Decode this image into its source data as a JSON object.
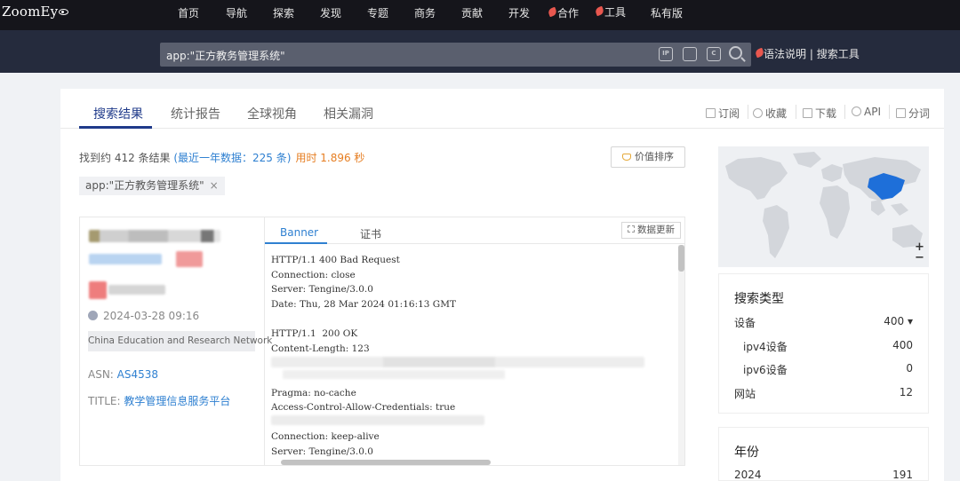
{
  "nav": {
    "logo": "ZoomEy",
    "items": [
      "首页",
      "导航",
      "探索",
      "发现",
      "专题",
      "商务",
      "贡献",
      "开发",
      "合作",
      "工具",
      "私有版"
    ]
  },
  "search": {
    "query": "app:\"正方教务管理系统\"",
    "icons": [
      "ip-icon",
      "hash-icon",
      "cert-icon",
      "search-icon"
    ],
    "icon_text": {
      "ip": "IP",
      "cert": "C"
    },
    "syntax_link": "语法说明",
    "divider": "|",
    "tools_link": "搜索工具"
  },
  "tabs": {
    "items": [
      "搜索结果",
      "统计报告",
      "全球视角",
      "相关漏洞"
    ],
    "active": 0
  },
  "toolbar": {
    "subscribe": "订阅",
    "favorite": "收藏",
    "download": "下载",
    "api": "API",
    "share": "分词"
  },
  "results": {
    "summary_prefix": "找到约 412 条结果 ",
    "recent": "(最近一年数据：225 条)",
    "time": "用时 1.896 秒",
    "sort_label": "价值排序",
    "filter_chip": "app:\"正方教务管理系统\"",
    "chip_close": "×"
  },
  "result_item": {
    "datetime": "2024-03-28 09:16",
    "org": "China Education and Research Network",
    "asn_label": "ASN: ",
    "asn": "AS4538",
    "title_label": "TITLE: ",
    "title": "教学管理信息服务平台",
    "tabs": [
      "Banner",
      "证书"
    ],
    "update_button": "数据更新",
    "banner_lines": [
      "HTTP/1.1 400 Bad Request",
      "Connection: close",
      "Server: Tengine/3.0.0",
      "Date: Thu, 28 Mar 2024 01:16:13 GMT",
      "",
      "HTTP/1.1  200 OK",
      "Content-Length: 123",
      "",
      "",
      "Pragma: no-cache",
      "Access-Control-Allow-Credentials: true",
      "",
      "Connection: keep-alive",
      "Server: Tengine/3.0.0"
    ]
  },
  "map": {
    "zoom_in": "+",
    "zoom_out": "−",
    "highlight_color": "#1e6fd9"
  },
  "search_type": {
    "title": "搜索类型",
    "rows": [
      {
        "label": "设备",
        "value": "400 ▾"
      },
      {
        "label": "ipv4设备",
        "value": "400"
      },
      {
        "label": "ipv6设备",
        "value": "0"
      },
      {
        "label": "网站",
        "value": "12"
      }
    ]
  },
  "year_section": {
    "title": "年份",
    "rows": [
      {
        "label": "2024",
        "value": "191"
      }
    ]
  }
}
